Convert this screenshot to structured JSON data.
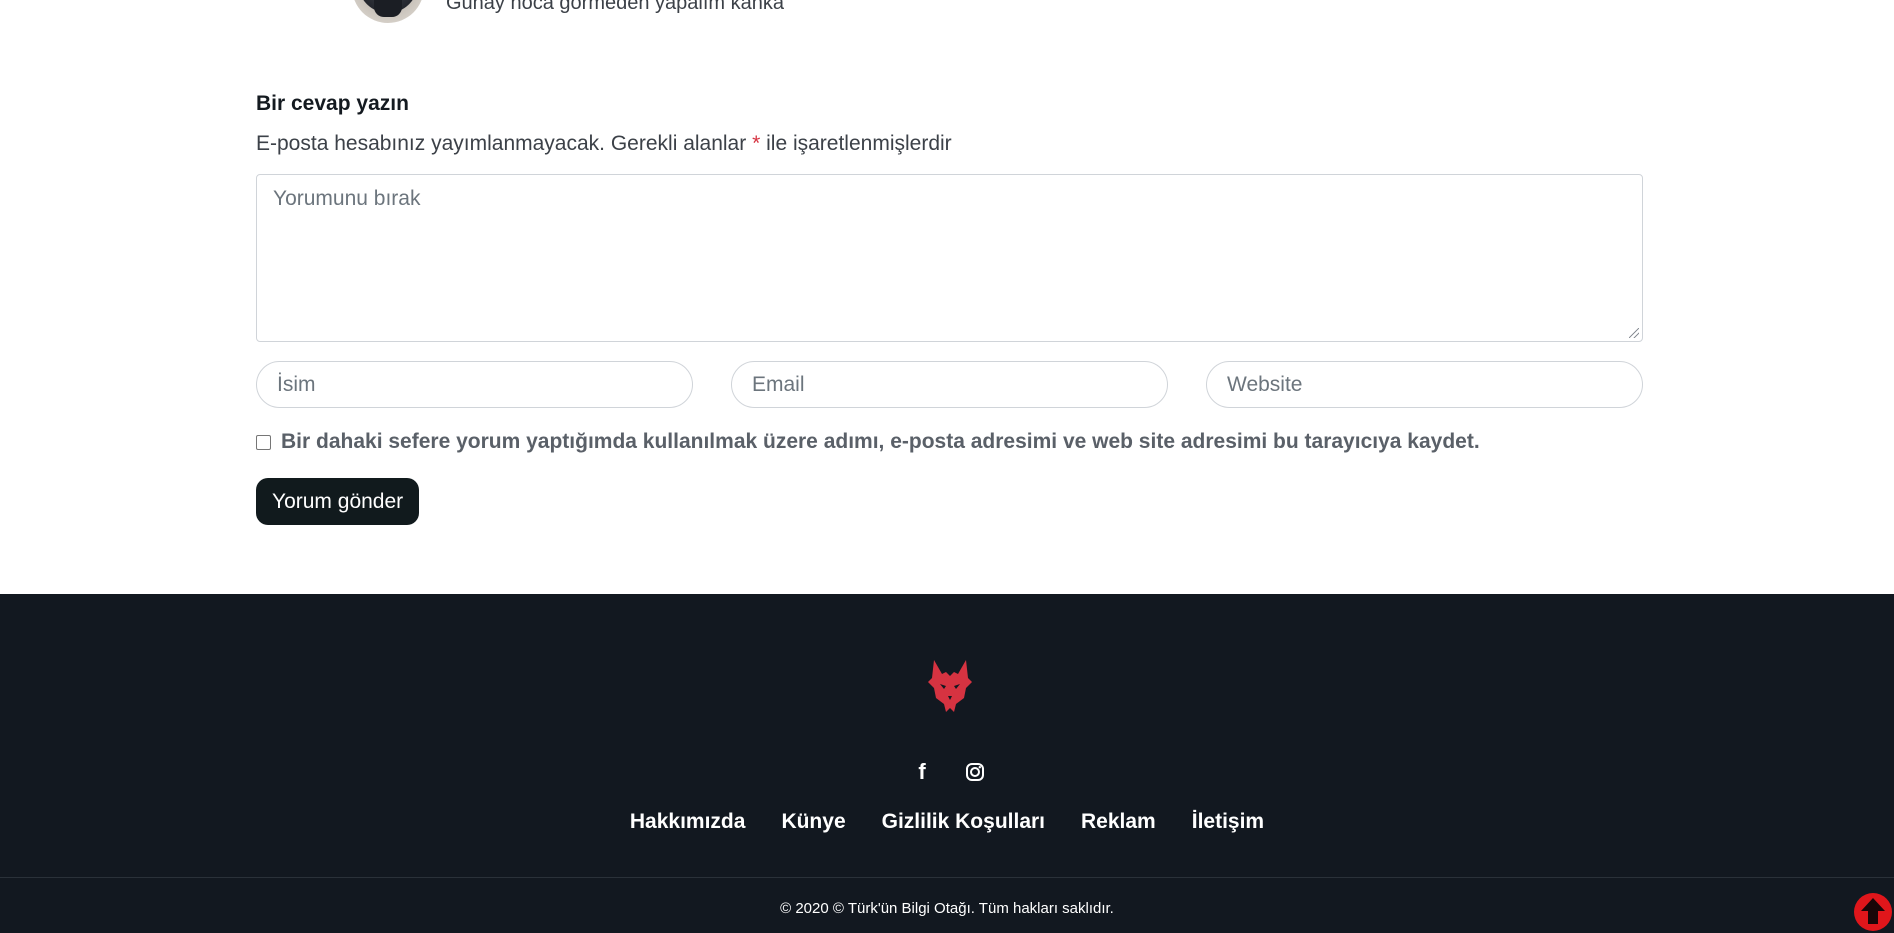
{
  "previous_comment": {
    "text": "Günay hoca görmeden yapalım kanka"
  },
  "reply": {
    "title": "Bir cevap yazın",
    "notes_prefix": "E-posta hesabınız yayımlanmayacak. Gerekli alanlar",
    "required_mark": "*",
    "notes_suffix": "ile işaretlenmişlerdir",
    "comment_placeholder": "Yorumunu bırak",
    "name_placeholder": "İsim",
    "email_placeholder": "Email",
    "website_placeholder": "Website",
    "consent_label": "Bir dahaki sefere yorum yaptığımda kullanılmak üzere adımı, e-posta adresimi ve web site adresimi bu tarayıcıya kaydet.",
    "consent_checked": false,
    "submit_label": "Yorum gönder"
  },
  "footer": {
    "logo_icon": "wolf-head-icon",
    "social": [
      {
        "name": "facebook-icon"
      },
      {
        "name": "instagram-icon"
      }
    ],
    "nav": [
      "Hakkımızda",
      "Künye",
      "Gizlilik Koşulları",
      "Reklam",
      "İletişim"
    ],
    "copyright": "© 2020 © Türk'ün Bilgi Otağı. Tüm hakları saklıdır.",
    "back_to_top_icon": "arrow-up-circle-icon"
  },
  "colors": {
    "footer_bg": "#121820",
    "accent_red": "#d63341",
    "button_dark": "#111a1d",
    "back_to_top_red": "#e0161b"
  }
}
